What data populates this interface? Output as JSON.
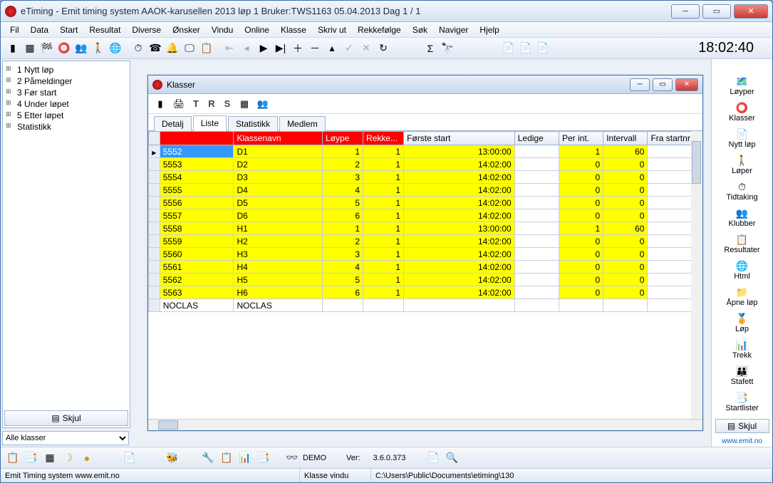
{
  "window": {
    "title": "eTiming - Emit timing system  AAOK-karusellen 2013 løp 1   Bruker:TWS1163   05.04.2013   Dag 1 / 1"
  },
  "menus": [
    "Fil",
    "Data",
    "Start",
    "Resultat",
    "Diverse",
    "Ønsker",
    "Vindu",
    "Online",
    "Klasse",
    "Skriv ut",
    "Rekkefølge",
    "Søk",
    "Naviger",
    "Hjelp"
  ],
  "clock": "18:02:40",
  "tree": [
    "1 Nytt løp",
    "2 Påmeldinger",
    "3 Før start",
    "4 Under løpet",
    "5 Etter løpet",
    "Statistikk"
  ],
  "skjul_btn": "Skjul",
  "left_combo": "Alle klasser",
  "inner": {
    "title": "Klasser",
    "tabs": [
      "Detalj",
      "Liste",
      "Statistikk",
      "Medlem"
    ],
    "active_tab": 1,
    "headers_red": [
      "",
      "Klassenavn",
      "Løype",
      "Rekke..."
    ],
    "headers_grey": [
      "Første start",
      "Ledige",
      "Per int.",
      "Intervall",
      "Fra startnr"
    ],
    "marker_head": ""
  },
  "rows": [
    {
      "id": "5552",
      "name": "D1",
      "loype": "1",
      "rekke": "1",
      "start": "13:00:00",
      "ledige": "",
      "perint": "1",
      "intervall": "60",
      "fra": ""
    },
    {
      "id": "5553",
      "name": "D2",
      "loype": "2",
      "rekke": "1",
      "start": "14:02:00",
      "ledige": "",
      "perint": "0",
      "intervall": "0",
      "fra": ""
    },
    {
      "id": "5554",
      "name": "D3",
      "loype": "3",
      "rekke": "1",
      "start": "14:02:00",
      "ledige": "",
      "perint": "0",
      "intervall": "0",
      "fra": ""
    },
    {
      "id": "5555",
      "name": "D4",
      "loype": "4",
      "rekke": "1",
      "start": "14:02:00",
      "ledige": "",
      "perint": "0",
      "intervall": "0",
      "fra": ""
    },
    {
      "id": "5556",
      "name": "D5",
      "loype": "5",
      "rekke": "1",
      "start": "14:02:00",
      "ledige": "",
      "perint": "0",
      "intervall": "0",
      "fra": ""
    },
    {
      "id": "5557",
      "name": "D6",
      "loype": "6",
      "rekke": "1",
      "start": "14:02:00",
      "ledige": "",
      "perint": "0",
      "intervall": "0",
      "fra": ""
    },
    {
      "id": "5558",
      "name": "H1",
      "loype": "1",
      "rekke": "1",
      "start": "13:00:00",
      "ledige": "",
      "perint": "1",
      "intervall": "60",
      "fra": ""
    },
    {
      "id": "5559",
      "name": "H2",
      "loype": "2",
      "rekke": "1",
      "start": "14:02:00",
      "ledige": "",
      "perint": "0",
      "intervall": "0",
      "fra": ""
    },
    {
      "id": "5560",
      "name": "H3",
      "loype": "3",
      "rekke": "1",
      "start": "14:02:00",
      "ledige": "",
      "perint": "0",
      "intervall": "0",
      "fra": ""
    },
    {
      "id": "5561",
      "name": "H4",
      "loype": "4",
      "rekke": "1",
      "start": "14:02:00",
      "ledige": "",
      "perint": "0",
      "intervall": "0",
      "fra": ""
    },
    {
      "id": "5562",
      "name": "H5",
      "loype": "5",
      "rekke": "1",
      "start": "14:02:00",
      "ledige": "",
      "perint": "0",
      "intervall": "0",
      "fra": ""
    },
    {
      "id": "5563",
      "name": "H6",
      "loype": "6",
      "rekke": "1",
      "start": "14:02:00",
      "ledige": "",
      "perint": "0",
      "intervall": "0",
      "fra": ""
    },
    {
      "id": "NOCLAS",
      "name": "NOCLAS",
      "loype": "",
      "rekke": "",
      "start": "",
      "ledige": "",
      "perint": "",
      "intervall": "",
      "fra": "",
      "plain": true
    }
  ],
  "right_panel": [
    {
      "icon": "🗺️",
      "label": "Løyper"
    },
    {
      "icon": "⭕",
      "label": "Klasser"
    },
    {
      "icon": "📄",
      "label": "Nytt løp"
    },
    {
      "icon": "🚶",
      "label": "Løper"
    },
    {
      "icon": "⏱",
      "label": "Tidtaking"
    },
    {
      "icon": "👥",
      "label": "Klubber"
    },
    {
      "icon": "📋",
      "label": "Resultater"
    },
    {
      "icon": "🌐",
      "label": "Html"
    },
    {
      "icon": "📁",
      "label": "Åpne løp"
    },
    {
      "icon": "🏅",
      "label": "Løp"
    },
    {
      "icon": "📊",
      "label": "Trekk"
    },
    {
      "icon": "👪",
      "label": "Stafett"
    },
    {
      "icon": "📑",
      "label": "Startlister"
    }
  ],
  "right_skjul": "Skjul",
  "bottom": {
    "demo": "DEMO",
    "ver_label": "Ver:",
    "ver": "3.6.0.373"
  },
  "status": {
    "left": "Emit Timing system www.emit.no",
    "mid": "Klasse vindu",
    "path": "C:\\Users\\Public\\Documents\\etiming\\130",
    "right": "www.emit.no"
  }
}
